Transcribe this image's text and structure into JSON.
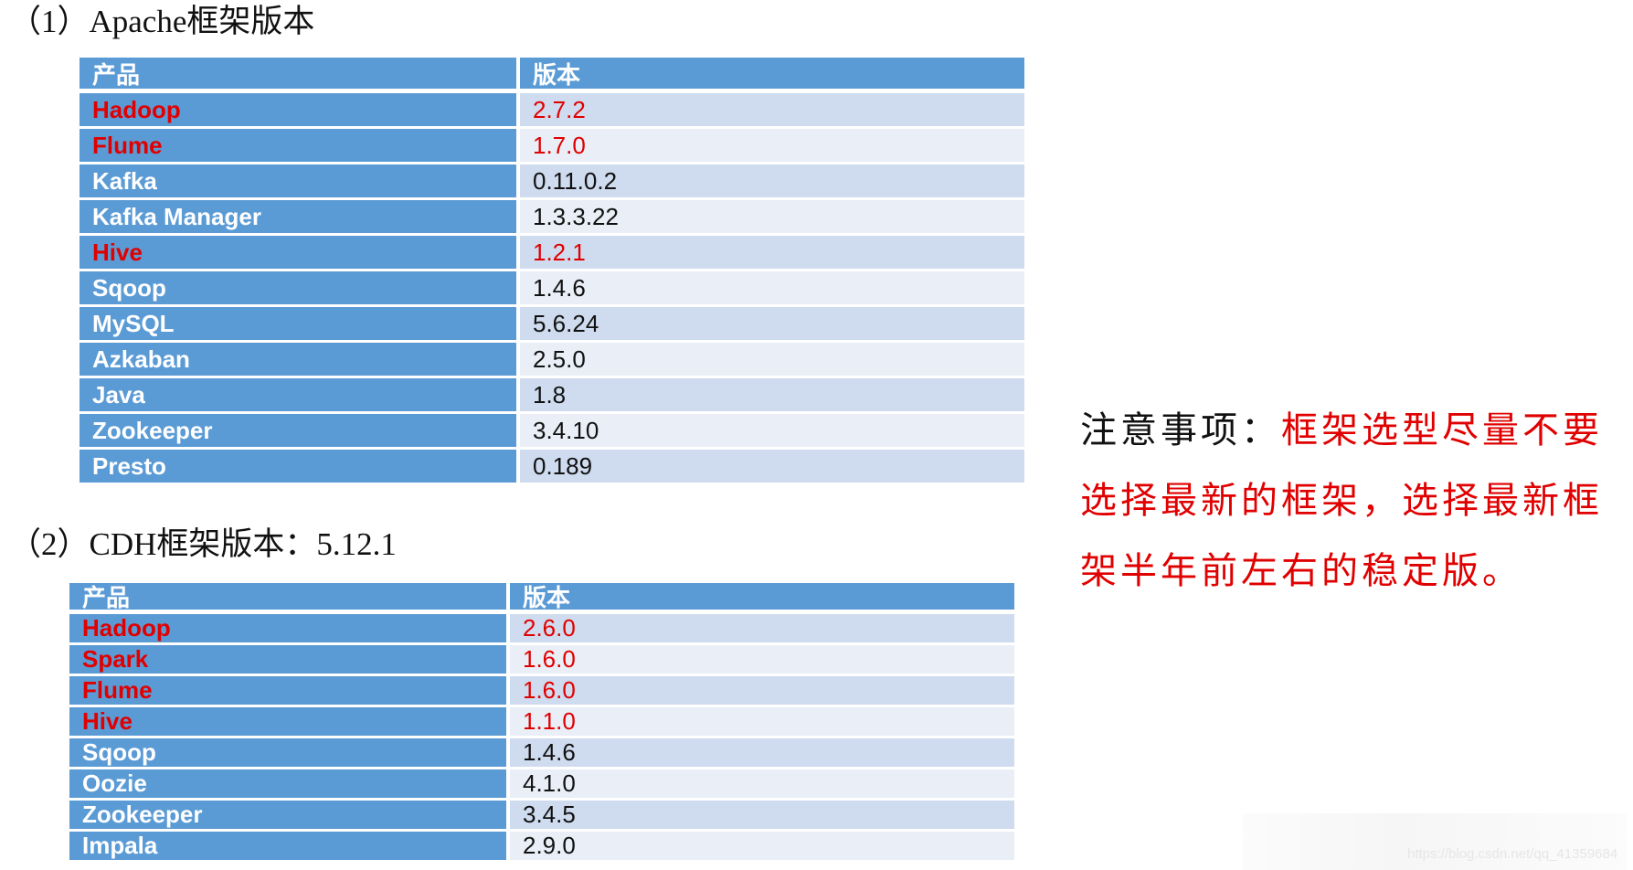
{
  "section1": {
    "title": "（1）Apache框架版本",
    "header": {
      "product": "产品",
      "version": "版本"
    },
    "rows": [
      {
        "product": "Hadoop",
        "version": "2.7.2",
        "highlight": true
      },
      {
        "product": "Flume",
        "version": "1.7.0",
        "highlight": true
      },
      {
        "product": "Kafka",
        "version": "0.11.0.2",
        "highlight": false
      },
      {
        "product": "Kafka Manager",
        "version": "1.3.3.22",
        "highlight": false
      },
      {
        "product": "Hive",
        "version": "1.2.1",
        "highlight": true
      },
      {
        "product": "Sqoop",
        "version": "1.4.6",
        "highlight": false
      },
      {
        "product": "MySQL",
        "version": "5.6.24",
        "highlight": false
      },
      {
        "product": "Azkaban",
        "version": "2.5.0",
        "highlight": false
      },
      {
        "product": "Java",
        "version": "1.8",
        "highlight": false
      },
      {
        "product": "Zookeeper",
        "version": "3.4.10",
        "highlight": false
      },
      {
        "product": "Presto",
        "version": "0.189",
        "highlight": false
      }
    ]
  },
  "section2": {
    "title": "（2）CDH框架版本：5.12.1",
    "header": {
      "product": "产品",
      "version": "版本"
    },
    "rows": [
      {
        "product": "Hadoop",
        "version": "2.6.0",
        "highlight": true
      },
      {
        "product": "Spark",
        "version": "1.6.0",
        "highlight": true
      },
      {
        "product": "Flume",
        "version": "1.6.0",
        "highlight": true
      },
      {
        "product": "Hive",
        "version": "1.1.0",
        "highlight": true
      },
      {
        "product": "Sqoop",
        "version": "1.4.6",
        "highlight": false
      },
      {
        "product": "Oozie",
        "version": "4.1.0",
        "highlight": false
      },
      {
        "product": "Zookeeper",
        "version": "3.4.5",
        "highlight": false
      },
      {
        "product": "Impala",
        "version": "2.9.0",
        "highlight": false
      }
    ]
  },
  "notes": {
    "label": "注意事项：",
    "text": "框架选型尽量不要选择最新的框架，选择最新框架半年前左右的稳定版。"
  },
  "watermark": "https://blog.csdn.net/qq_41359684",
  "colors": {
    "header_blue": "#5b9bd5",
    "row_dark": "#cfdbee",
    "row_light": "#e9eef7",
    "highlight_red": "#e00000"
  }
}
